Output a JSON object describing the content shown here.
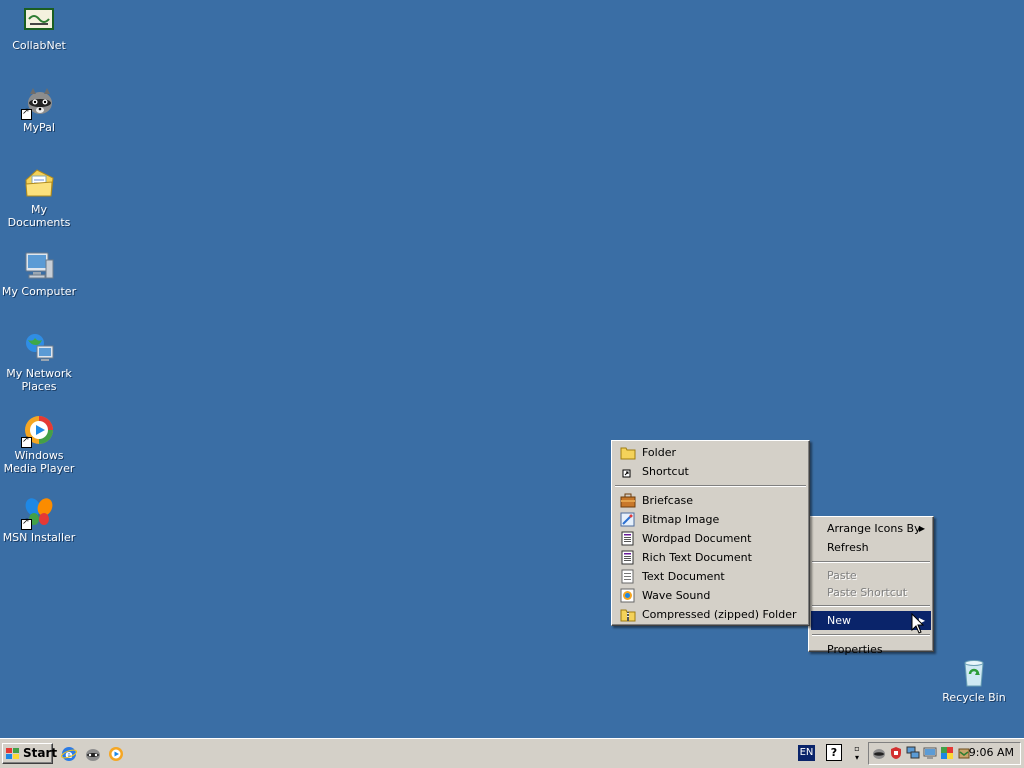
{
  "desktop": {
    "background": "#3a6ea5",
    "icons": [
      {
        "label": "CollabNet",
        "icon": "collabnet-icon"
      },
      {
        "label": "MyPal",
        "icon": "raccoon-icon"
      },
      {
        "label": "My Documents",
        "icon": "my-documents-icon"
      },
      {
        "label": "My Computer",
        "icon": "my-computer-icon"
      },
      {
        "label": "My Network Places",
        "icon": "network-places-icon"
      },
      {
        "label": "Windows Media Player",
        "icon": "media-player-icon"
      },
      {
        "label": "MSN Installer",
        "icon": "msn-butterfly-icon"
      },
      {
        "label": "Recycle Bin",
        "icon": "recycle-bin-icon"
      }
    ]
  },
  "context_menu": {
    "items": [
      {
        "label": "Arrange Icons By",
        "submenu": true
      },
      {
        "label": "Refresh"
      },
      {
        "label": "Paste",
        "disabled": true
      },
      {
        "label": "Paste Shortcut",
        "disabled": true
      },
      {
        "label": "New",
        "submenu": true,
        "active": true
      },
      {
        "label": "Properties"
      }
    ]
  },
  "new_submenu": {
    "items": [
      {
        "label": "Folder",
        "icon": "folder-icon"
      },
      {
        "label": "Shortcut",
        "icon": "shortcut-icon"
      },
      {
        "label": "Briefcase",
        "icon": "briefcase-icon"
      },
      {
        "label": "Bitmap Image",
        "icon": "bitmap-icon"
      },
      {
        "label": "Wordpad Document",
        "icon": "wordpad-icon"
      },
      {
        "label": "Rich Text Document",
        "icon": "rich-text-icon"
      },
      {
        "label": "Text Document",
        "icon": "text-document-icon"
      },
      {
        "label": "Wave Sound",
        "icon": "wave-sound-icon"
      },
      {
        "label": "Compressed (zipped) Folder",
        "icon": "zip-folder-icon"
      }
    ]
  },
  "taskbar": {
    "start_label": "Start",
    "quick_launch": [
      "internet-explorer-icon",
      "mypal-icon",
      "media-player-icon"
    ],
    "language": "EN",
    "help_glyph": "?",
    "clock": "9:06 AM"
  },
  "colors": {
    "menu_bg": "#d4d0c8",
    "highlight": "#0a246a",
    "disabled_text": "#808080"
  }
}
